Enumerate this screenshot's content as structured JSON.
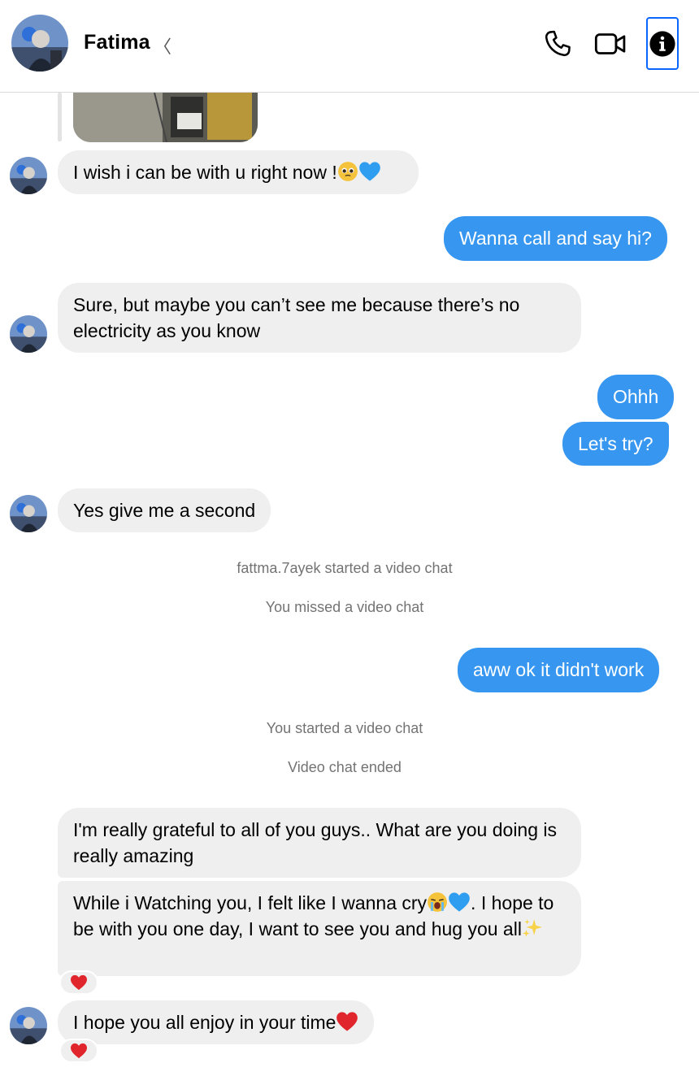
{
  "header": {
    "contact_name": "Fatima",
    "name_glyph": "〈",
    "icons": [
      "phone-icon",
      "video-camera-icon",
      "info-icon"
    ]
  },
  "messages": {
    "m1": "I wish i can be with u right now !",
    "m2": "Wanna call and say hi?",
    "m3": "Sure, but maybe you can’t see me because there’s no electricity as you know",
    "m4": "Ohhh",
    "m5": "Let's try?",
    "m6": "Yes give me a second",
    "s1": "fattma.7ayek started a video chat",
    "s2": "You missed a video chat",
    "m7": "aww ok it didn't work",
    "s3": "You started a video chat",
    "s4": "Video chat ended",
    "m8": "I'm really grateful to all of you guys.. What are you doing is really amazing",
    "m9a": "While i Watching you, I felt like I wanna cry",
    "m9b": ". I hope to be with you one day, I want to see you and hug you all",
    "m10": "I hope you all enjoy in your time"
  },
  "colors": {
    "outgoing_bubble": "#3797f0",
    "incoming_bubble": "#efefef",
    "system_text": "#737373",
    "info_focus": "#0a66ff"
  }
}
